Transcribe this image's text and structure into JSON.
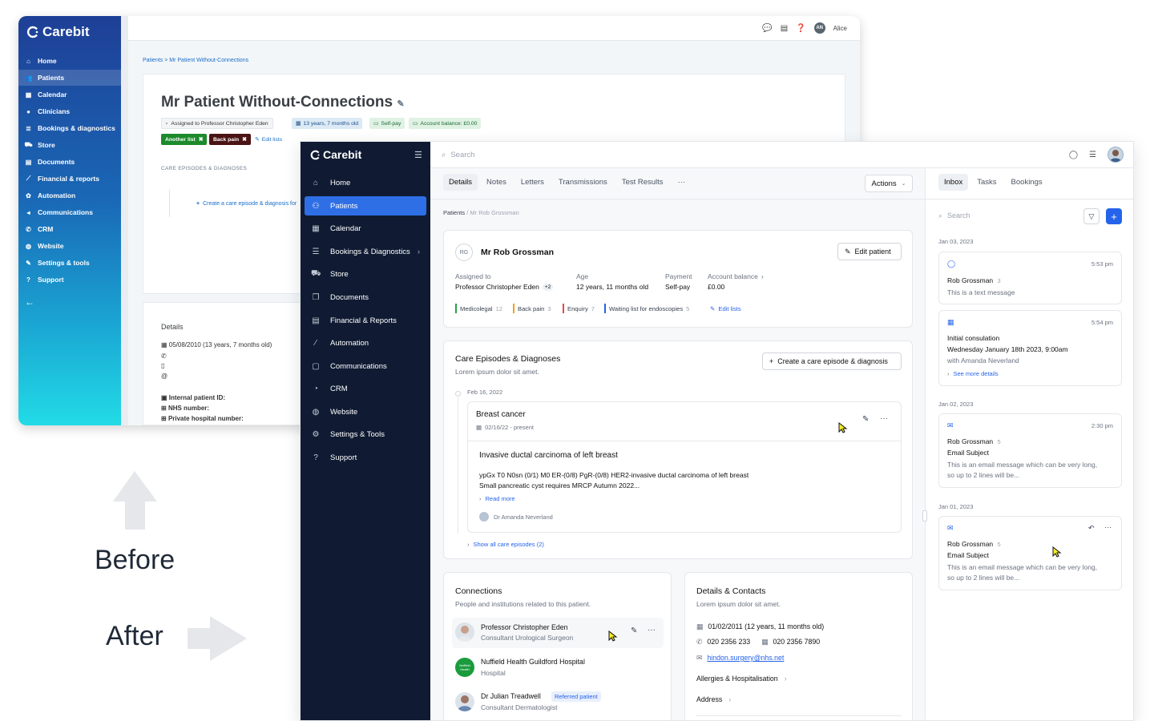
{
  "before": {
    "logo": "Carebit",
    "nav": [
      "Home",
      "Patients",
      "Calendar",
      "Clinicians",
      "Bookings & diagnostics",
      "Store",
      "Documents",
      "Financial & reports",
      "Automation",
      "Communications",
      "CRM",
      "Website",
      "Settings & tools",
      "Support"
    ],
    "user": "Alice",
    "user_initials": "AN",
    "breadcrumb": "Patients > Mr Patient Without-Connections",
    "patient_name": "Mr Patient Without-Connections",
    "assigned": "Assigned to Professor Christopher Eden",
    "age": "13 years, 7 months old",
    "payment": "Self-pay",
    "balance": "Account balance: £0.00",
    "list1": "Another list",
    "list2": "Back pain",
    "edit_lists": "Edit lists",
    "episodes_heading": "CARE EPISODES & DIAGNOSES",
    "create_episode": "Create a care episode & diagnosis for",
    "details_heading": "Details",
    "dob": "05/08/2010 (13 years, 7 months old)",
    "internal_id": "Internal patient ID:",
    "nhs": "NHS number:",
    "private": "Private hospital number:"
  },
  "labels": {
    "before": "Before",
    "after": "After"
  },
  "after": {
    "logo": "Carebit",
    "nav": [
      "Home",
      "Patients",
      "Calendar",
      "Bookings & Diagnostics",
      "Store",
      "Documents",
      "Financial & Reports",
      "Automation",
      "Communications",
      "CRM",
      "Website",
      "Settings & Tools",
      "Support"
    ],
    "search_placeholder": "Search",
    "tabs": [
      "Details",
      "Notes",
      "Letters",
      "Transmissions",
      "Test Results",
      "···"
    ],
    "actions": "Actions",
    "breadcrumb_root": "Patients",
    "breadcrumb_current": "Mr Rob Grossman",
    "patient": {
      "initials": "RG",
      "name": "Mr Rob Grossman",
      "edit": "Edit patient",
      "assigned_label": "Assigned to",
      "assigned_value": "Professor Christopher Eden",
      "assigned_more": "+2",
      "age_label": "Age",
      "age_value": "12 years, 11 months old",
      "payment_label": "Payment",
      "payment_value": "Self-pay",
      "balance_label": "Account balance",
      "balance_value": "£0.00",
      "lists": [
        {
          "name": "Medicolegal",
          "count": "12",
          "color": "#22a34a"
        },
        {
          "name": "Back pain",
          "count": "3",
          "color": "#f59e0b"
        },
        {
          "name": "Enquiry",
          "count": "7",
          "color": "#ef4444"
        },
        {
          "name": "Waiting list for endoscopies",
          "count": "5",
          "color": "#2563eb"
        }
      ],
      "edit_lists": "Edit lists"
    },
    "episodes": {
      "title": "Care Episodes & Diagnoses",
      "subtitle": "Lorem ipsum dolor sit amet.",
      "create": "Create a care episode & diagnosis",
      "date": "Feb 16, 2022",
      "episode_title": "Breast cancer",
      "episode_range": "02/16/22 - present",
      "diagnosis": "Invasive ductal carcinoma of left breast",
      "line1": "ypGx T0 N0sn (0/1) M0 ER-(0/8) PgR-(0/8) HER2-invasive ductal carcinoma of left breast",
      "line2": "Small pancreatic cyst requires MRCP Autumn 2022...",
      "read_more": "Read more",
      "doctor": "Dr Amanda Neverland",
      "show_all": "Show all care episodes (2)"
    },
    "connections": {
      "title": "Connections",
      "subtitle": "People and institutions related to this patient.",
      "items": [
        {
          "name": "Professor Christopher Eden",
          "role": "Consultant Urological Surgeon"
        },
        {
          "name": "Nuffield Health Guildford Hospital",
          "role": "Hospital",
          "logo_text": "Nuffield Health"
        },
        {
          "name": "Dr Julian Treadwell",
          "role": "Consultant Dermatologist",
          "badge": "Referred patient"
        }
      ]
    },
    "details": {
      "title": "Details & Contacts",
      "subtitle": "Lorem ipsum dolor sit amet.",
      "dob": "01/02/2011 (12 years, 11 months old)",
      "phone1": "020 2356 233",
      "phone2": "020 2356 7890",
      "email": "hindon.surgery@nhs.net",
      "allergies": "Allergies & Hospitalisation",
      "address": "Address"
    },
    "inbox": {
      "tabs": [
        "Inbox",
        "Tasks",
        "Bookings"
      ],
      "search_placeholder": "Search",
      "groups": [
        {
          "date": "Jan 03, 2023"
        },
        {
          "date": "Jan 02, 2023"
        },
        {
          "date": "Jan 01, 2023"
        }
      ],
      "m1": {
        "time": "5:53 pm",
        "from": "Rob Grossman",
        "count": "3",
        "body": "This is a text message"
      },
      "m2": {
        "time": "5:54 pm",
        "title": "Initial consulation",
        "when": "Wednesday January 18th 2023, 9:00am",
        "with": "with Amanda Neverland",
        "more": "See more details"
      },
      "m3": {
        "time": "2:30 pm",
        "from": "Rob Grossman",
        "count": "5",
        "subject": "Email Subject",
        "body1": "This is an email message which can be very long,",
        "body2": "so up to 2 lines will be..."
      },
      "m4": {
        "from": "Rob Grossman",
        "count": "5",
        "subject": "Email Subject",
        "body1": "This is an email message which can be very long,",
        "body2": "so up to 2 lines will be..."
      }
    }
  },
  "colors": {
    "accent": "#2f6fe6",
    "sidebar": "#101b33",
    "before_gradient_top": "#1e3f96",
    "before_gradient_bottom": "#22dbe6"
  }
}
